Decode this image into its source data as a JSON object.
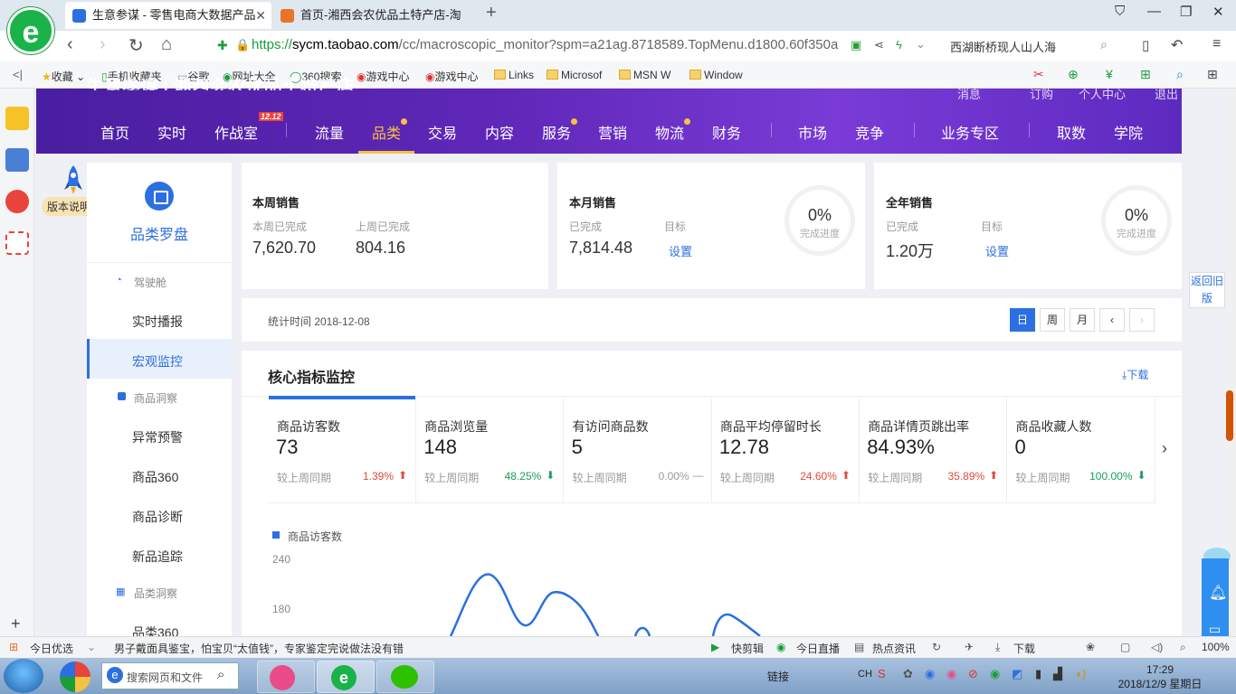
{
  "browser": {
    "tabs": [
      {
        "label": "生意参谋 - 零售电商大数据产品",
        "active": true
      },
      {
        "label": "首页-湘西会农优品土特产店-淘宝",
        "active": false
      }
    ],
    "url_prefix": "https://",
    "url_host": "sycm.taobao.com",
    "url_path": "/cc/macroscopic_monitor?spm=a21ag.8718589.TopMenu.d1800.60f350a",
    "search_text": "西湖断桥现人山人海",
    "bookmarks": [
      "收藏",
      "手机收藏夹",
      "谷歌",
      "网址大全",
      "360搜索",
      "游戏中心",
      "游戏中心",
      "Links",
      "Microsof",
      "MSN W",
      "Window"
    ]
  },
  "sycm": {
    "title": "生意参谋 | 湘西会农优品土特产店",
    "top_links": [
      "消息",
      "订购",
      "个人中心",
      "退出"
    ],
    "nav": [
      {
        "label": "首页"
      },
      {
        "label": "实时"
      },
      {
        "label": "作战室",
        "badge": "12.12"
      },
      {
        "label": "流量"
      },
      {
        "label": "品类",
        "active": true,
        "dot": true
      },
      {
        "label": "交易"
      },
      {
        "label": "内容"
      },
      {
        "label": "服务",
        "dot": true
      },
      {
        "label": "营销"
      },
      {
        "label": "物流",
        "dot": true
      },
      {
        "label": "财务"
      },
      {
        "label": "市场"
      },
      {
        "label": "竞争"
      },
      {
        "label": "业务专区"
      },
      {
        "label": "取数"
      },
      {
        "label": "学院"
      }
    ],
    "rocket_label": "版本说明",
    "back_old": "返回旧版"
  },
  "menu": {
    "title": "品类罗盘",
    "sections": [
      {
        "label": "驾驶舱",
        "items": [
          "实时播报",
          "宏观监控"
        ]
      },
      {
        "label": "商品洞察",
        "items": [
          "异常预警",
          "商品360",
          "商品诊断",
          "新品追踪"
        ]
      },
      {
        "label": "品类洞察",
        "items": [
          "品类360"
        ]
      }
    ],
    "active_item": "宏观监控"
  },
  "cards": {
    "week": {
      "title": "本周销售",
      "label1": "本周已完成",
      "value1": "7,620.70",
      "label2": "上周已完成",
      "value2": "804.16"
    },
    "month": {
      "title": "本月销售",
      "label1": "已完成",
      "value1": "7,814.48",
      "label2": "目标",
      "link": "设置",
      "progress_pct": "0%",
      "progress_label": "完成进度"
    },
    "year": {
      "title": "全年销售",
      "label1": "已完成",
      "value1": "1.20万",
      "label2": "目标",
      "link": "设置",
      "progress_pct": "0%",
      "progress_label": "完成进度"
    }
  },
  "timebar": {
    "stat_time": "统计时间 2018-12-08",
    "buttons": [
      "日",
      "周",
      "月"
    ],
    "active": "日"
  },
  "core": {
    "title": "核心指标监控",
    "download": "下载",
    "compare_label": "较上周同期",
    "metrics": [
      {
        "name": "商品访客数",
        "value": "73",
        "pct": "1.39%",
        "trend": "up"
      },
      {
        "name": "商品浏览量",
        "value": "148",
        "pct": "48.25%",
        "trend": "down"
      },
      {
        "name": "有访问商品数",
        "value": "5",
        "pct": "0.00%",
        "trend": "flat"
      },
      {
        "name": "商品平均停留时长",
        "value": "12.78",
        "pct": "24.60%",
        "trend": "up"
      },
      {
        "name": "商品详情页跳出率",
        "value": "84.93%",
        "pct": "35.89%",
        "trend": "up"
      },
      {
        "name": "商品收藏人数",
        "value": "0",
        "pct": "100.00%",
        "trend": "down"
      }
    ],
    "legend": "商品访客数",
    "y_ticks": [
      "240",
      "180"
    ]
  },
  "statusbar": {
    "left1": "今日优选",
    "news": "男子戴面具鉴宝，怕宝贝“太值钱”，专家鉴定完说做法没有错",
    "items": [
      "快剪辑",
      "今日直播",
      "热点资讯",
      "下载"
    ],
    "zoom": "100%"
  },
  "taskbar": {
    "search_placeholder": "搜索网页和文件",
    "tray_link": "链接",
    "time": "17:29",
    "date": "2018/12/9 星期日"
  },
  "colors": {
    "accent": "#2c6fe0",
    "header_purple": "#5f27b8",
    "nav_highlight": "#f5c242",
    "up": "#e04a3a",
    "down": "#19a05a"
  }
}
